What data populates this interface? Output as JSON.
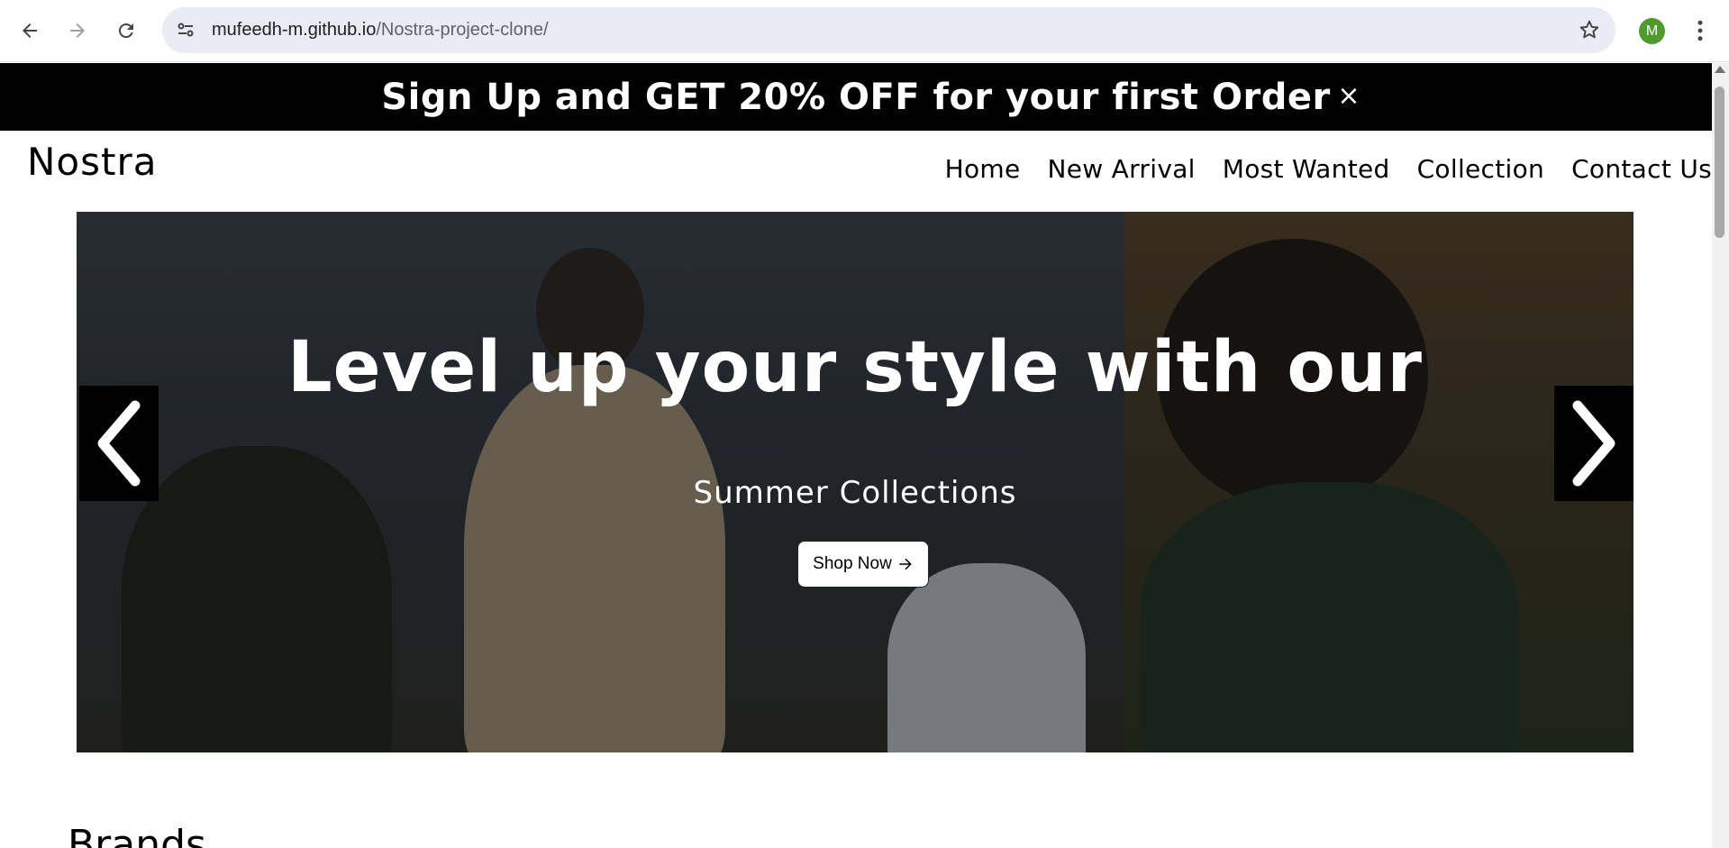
{
  "browser": {
    "url_host": "mufeedh-m.github.io",
    "url_path": "/Nostra-project-clone/",
    "profile_initial": "M",
    "icons": [
      "back-icon",
      "forward-icon",
      "reload-icon",
      "site-settings-icon",
      "bookmark-star-icon",
      "more-vert-icon"
    ]
  },
  "promo": {
    "text": "Sign Up and GET 20% OFF for your first Order",
    "close_label": "×"
  },
  "header": {
    "logo": "Nostra",
    "nav": [
      "Home",
      "New Arrival",
      "Most Wanted",
      "Collection",
      "Contact Us"
    ]
  },
  "hero": {
    "title": "Level up your style with our",
    "subtitle": "Summer Collections",
    "cta_label": "Shop Now",
    "cta_icon": "arrow-right-icon",
    "prev_icon": "chevron-left-icon",
    "next_icon": "chevron-right-icon"
  },
  "sections": {
    "brands_heading": "Brands"
  },
  "colors": {
    "promo_bg": "#000000",
    "omnibox_bg": "#e9ecf5",
    "avatar_bg": "#4e9a2a"
  }
}
